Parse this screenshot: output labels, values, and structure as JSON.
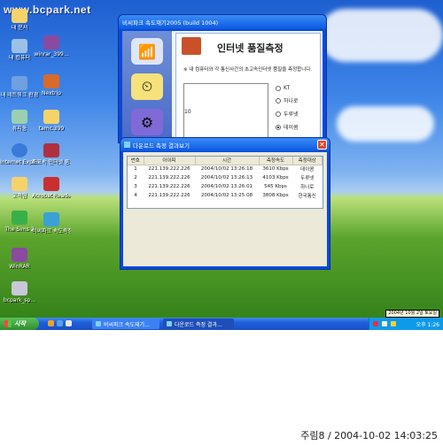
{
  "watermark": "www.bcpark.net",
  "desktop_icons": [
    {
      "label": "내 문서",
      "icon": "folder-icon"
    },
    {
      "label": "내 컴퓨터",
      "icon": "computer-icon"
    },
    {
      "label": "내 네트워크 환경",
      "icon": "network-icon"
    },
    {
      "label": "휴지통",
      "icon": "recycle-bin-icon"
    },
    {
      "label": "Internet Explorer",
      "icon": "ie-icon"
    },
    {
      "label": "고객팀",
      "icon": "folder-icon"
    },
    {
      "label": "The Sims 2",
      "icon": "sims-icon"
    },
    {
      "label": "WinRAR",
      "icon": "winrar-icon"
    },
    {
      "label": "bcpark_sp...",
      "icon": "setup-icon"
    },
    {
      "label": "winrar_399...",
      "icon": "winrar-icon"
    },
    {
      "label": "Nextrip",
      "icon": "app-icon"
    },
    {
      "label": "tamc.399",
      "icon": "folder-icon"
    },
    {
      "label": "초고속 인터넷 품...",
      "icon": "app-icon"
    },
    {
      "label": "Acrobat Reader 5.0",
      "icon": "acrobat-icon"
    },
    {
      "label": "비씨파크 속도측정",
      "icon": "app-icon"
    }
  ],
  "main_window": {
    "title": "비씨파크 속도재기2005 (build 1004)",
    "heading": "인터넷 품질측정",
    "description": "※ 내 컴퓨터와 각 통신사간의 초고속인터넷 품질을 측정합니다.",
    "chart_label": "10",
    "providers": [
      {
        "label": "KT",
        "selected": false
      },
      {
        "label": "하나로",
        "selected": false
      },
      {
        "label": "두루넷",
        "selected": false
      },
      {
        "label": "데이콤",
        "selected": true
      }
    ]
  },
  "result_window": {
    "title": "다운로드 측정 결과보기",
    "columns": [
      "번호",
      "아이피",
      "시간",
      "측정속도",
      "측정대상"
    ],
    "rows": [
      [
        "1",
        "221.139.222.226",
        "2004/10/02 13:26:18",
        "3610 Kbps",
        "데이콤"
      ],
      [
        "2",
        "221.139.222.226",
        "2004/10/02 13:26:13",
        "4103 Kbps",
        "두루넷"
      ],
      [
        "3",
        "221.139.222.226",
        "2004/10/02 13:26:01",
        "545 Kbps",
        "하나로"
      ],
      [
        "4",
        "221.139.222.226",
        "2004/10/02 13:25:08",
        "3808 Kbps",
        "한국통신"
      ]
    ]
  },
  "taskbar": {
    "start_label": "시작",
    "tasks": [
      "비씨파크 속도재기...",
      "다운로드 측정 결과..."
    ],
    "clock": "오후 1:26",
    "date_tooltip": "2004년 10월 2일 토요일"
  },
  "stamp": "주림8 / 2004-10-02 14:03:25"
}
